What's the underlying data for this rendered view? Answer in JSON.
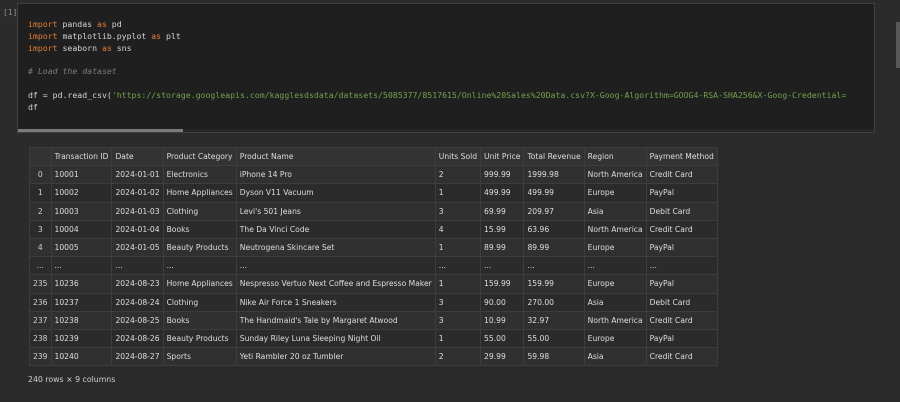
{
  "cell": {
    "execution_count": "[1]",
    "code": {
      "line1": {
        "kw1": "import",
        "mod": " pandas ",
        "kw2": "as",
        "alias": " pd"
      },
      "line2": {
        "kw1": "import",
        "mod": " matplotlib.pyplot ",
        "kw2": "as",
        "alias": " plt"
      },
      "line3": {
        "kw1": "import",
        "mod": " seaborn ",
        "kw2": "as",
        "alias": " sns"
      },
      "comment": "# Load the dataset",
      "line5_prefix": "df = pd.read_csv(",
      "line5_string": "'https://storage.googleapis.com/kagglesdsdata/datasets/5085377/8517615/Online%20Sales%20Data.csv?X-Goog-Algorithm=GOOG4-RSA-SHA256&X-Goog-Credential=",
      "line6": "df"
    }
  },
  "output": {
    "columns": [
      "Transaction ID",
      "Date",
      "Product Category",
      "Product Name",
      "Units Sold",
      "Unit Price",
      "Total Revenue",
      "Region",
      "Payment Method"
    ],
    "rows": [
      [
        "0",
        "10001",
        "2024-01-01",
        "Electronics",
        "iPhone 14 Pro",
        "2",
        "999.99",
        "1999.98",
        "North America",
        "Credit Card"
      ],
      [
        "1",
        "10002",
        "2024-01-02",
        "Home Appliances",
        "Dyson V11 Vacuum",
        "1",
        "499.99",
        "499.99",
        "Europe",
        "PayPal"
      ],
      [
        "2",
        "10003",
        "2024-01-03",
        "Clothing",
        "Levi's 501 Jeans",
        "3",
        "69.99",
        "209.97",
        "Asia",
        "Debit Card"
      ],
      [
        "3",
        "10004",
        "2024-01-04",
        "Books",
        "The Da Vinci Code",
        "4",
        "15.99",
        "63.96",
        "North America",
        "Credit Card"
      ],
      [
        "4",
        "10005",
        "2024-01-05",
        "Beauty Products",
        "Neutrogena Skincare Set",
        "1",
        "89.99",
        "89.99",
        "Europe",
        "PayPal"
      ],
      [
        "...",
        "...",
        "...",
        "...",
        "...",
        "...",
        "...",
        "...",
        "...",
        "..."
      ],
      [
        "235",
        "10236",
        "2024-08-23",
        "Home Appliances",
        "Nespresso Vertuo Next Coffee and Espresso Maker",
        "1",
        "159.99",
        "159.99",
        "Europe",
        "PayPal"
      ],
      [
        "236",
        "10237",
        "2024-08-24",
        "Clothing",
        "Nike Air Force 1 Sneakers",
        "3",
        "90.00",
        "270.00",
        "Asia",
        "Debit Card"
      ],
      [
        "237",
        "10238",
        "2024-08-25",
        "Books",
        "The Handmaid's Tale by Margaret Atwood",
        "3",
        "10.99",
        "32.97",
        "North America",
        "Credit Card"
      ],
      [
        "238",
        "10239",
        "2024-08-26",
        "Beauty Products",
        "Sunday Riley Luna Sleeping Night Oil",
        "1",
        "55.00",
        "55.00",
        "Europe",
        "PayPal"
      ],
      [
        "239",
        "10240",
        "2024-08-27",
        "Sports",
        "Yeti Rambler 20 oz Tumbler",
        "2",
        "29.99",
        "59.98",
        "Asia",
        "Credit Card"
      ]
    ],
    "shape": "240 rows × 9 columns"
  }
}
